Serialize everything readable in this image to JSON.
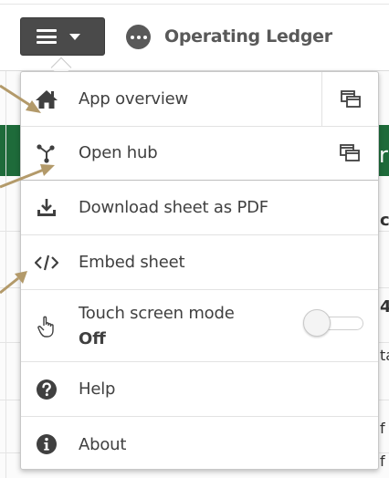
{
  "app": {
    "title": "Operating Ledger"
  },
  "menu": {
    "items": [
      {
        "id": "app-overview",
        "label": "App overview",
        "icon": "home-icon",
        "open_in_new_tab": true
      },
      {
        "id": "open-hub",
        "label": "Open hub",
        "icon": "hub-icon",
        "open_in_new_tab": true
      },
      {
        "id": "download-pdf",
        "label": "Download sheet as PDF",
        "icon": "download-icon"
      },
      {
        "id": "embed-sheet",
        "label": "Embed sheet",
        "icon": "code-icon"
      },
      {
        "id": "touch-mode",
        "label": "Touch screen mode",
        "value": "Off",
        "icon": "touch-icon",
        "toggle_on": false
      },
      {
        "id": "help",
        "label": "Help",
        "icon": "help-icon"
      },
      {
        "id": "about",
        "label": "About",
        "icon": "info-icon"
      }
    ]
  },
  "background_fragments": {
    "char_1": "r",
    "char_2": "c",
    "char_3": "4",
    "char_4": "ta",
    "char_5": "f A",
    "char_6": "f A"
  },
  "colors": {
    "menu_button_bg": "#4a4a4a",
    "annotation_arrow": "#b39a6a",
    "header_band": "#1e6b3a",
    "text": "#404040"
  }
}
